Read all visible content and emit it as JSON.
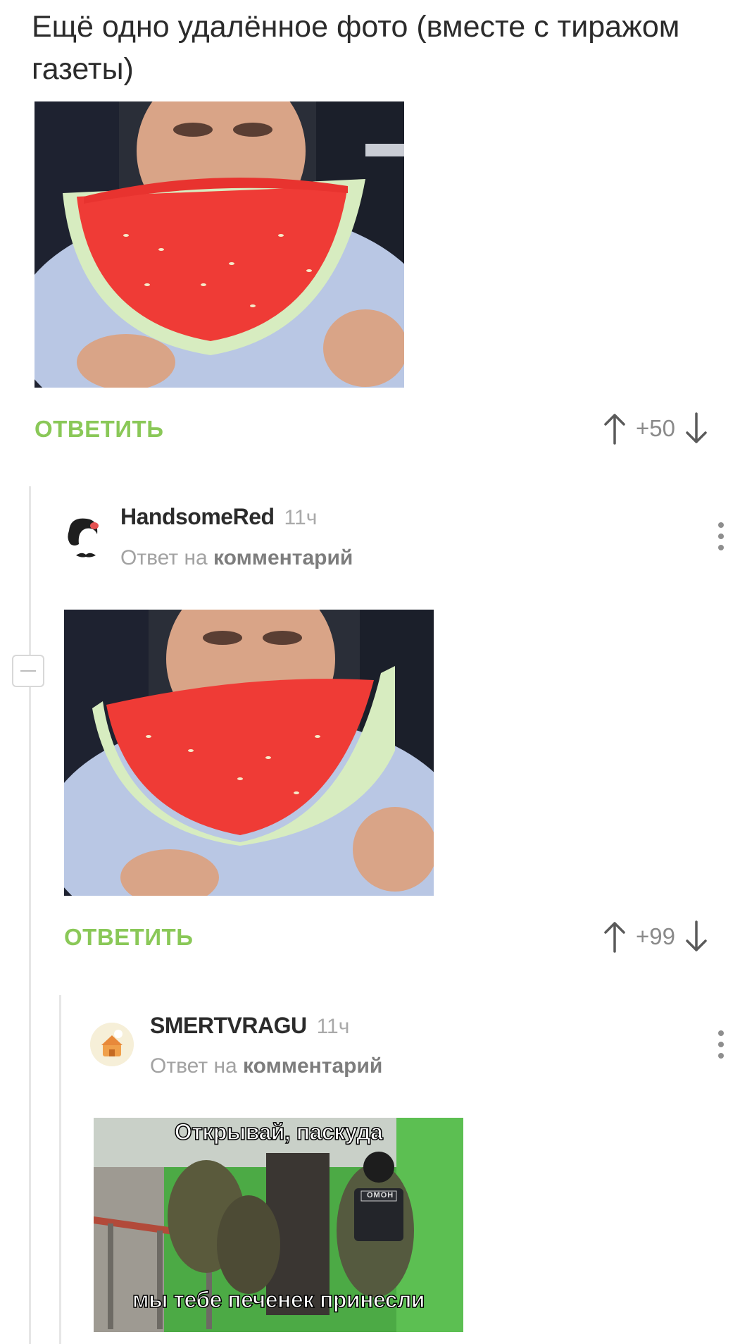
{
  "post": {
    "text": "Ещё одно удалённое фото (вместе с тиражом газеты)",
    "reply_label": "ОТВЕТИТЬ",
    "rating": "+50"
  },
  "comment1": {
    "author": "HandsomeRed",
    "time": "11ч",
    "reply_prefix": "Ответ на",
    "reply_link": "комментарий",
    "reply_label": "ОТВЕТИТЬ",
    "rating": "+99"
  },
  "comment2": {
    "author": "SMERTVRAGU",
    "time": "11ч",
    "reply_prefix": "Ответ на",
    "reply_link": "комментарий",
    "meme_top": "Открывай, паскуда",
    "meme_bottom": "мы тебе печенек принесли",
    "meme_badge": "ОМОН"
  },
  "icons": [
    "arrow-up-icon",
    "arrow-down-icon",
    "more-vertical-icon",
    "collapse-icon"
  ],
  "colors": {
    "accent": "#8ac858",
    "text": "#2b2b2b",
    "muted": "#a2a2a2"
  }
}
